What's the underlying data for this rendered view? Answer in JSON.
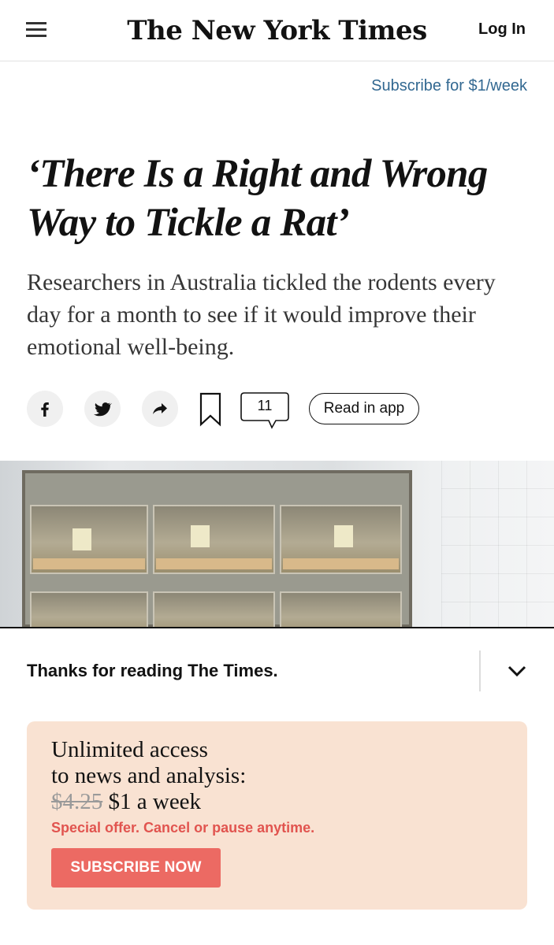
{
  "header": {
    "masthead": "The New York Times",
    "login_label": "Log In"
  },
  "subscribe_link": "Subscribe for $1/week",
  "article": {
    "headline": "‘There Is a Right and Wrong Way to Tickle a Rat’",
    "summary": "Researchers in Australia tickled the rodents every day for a month to see if it would improve their emotional well-being."
  },
  "share": {
    "icons": [
      "facebook-icon",
      "twitter-icon",
      "share-arrow-icon",
      "bookmark-icon",
      "comment-bubble-icon"
    ],
    "comment_count": "11",
    "read_in_app_label": "Read in app"
  },
  "thanks_bar": {
    "text": "Thanks for reading The Times.",
    "icon": "chevron-down-icon"
  },
  "offer": {
    "line1": "Unlimited access",
    "line2": "to news and analysis:",
    "old_price": "$4.25",
    "new_price": "$1 a week",
    "special_text": "Special offer. Cancel or pause anytime.",
    "cta_label": "SUBSCRIBE NOW",
    "colors": {
      "card_bg": "#f9e2d2",
      "accent": "#ec6a63",
      "special_text": "#e1544f"
    }
  },
  "colors": {
    "link": "#326891",
    "text": "#121212"
  }
}
